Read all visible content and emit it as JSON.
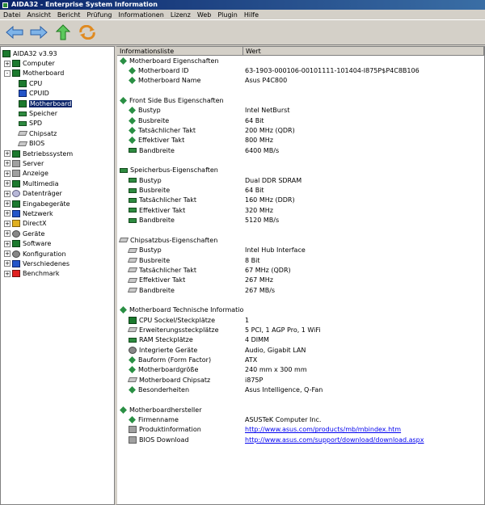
{
  "window": {
    "title": "AIDA32 - Enterprise System Information"
  },
  "menu": [
    "Datei",
    "Ansicht",
    "Bericht",
    "Prüfung",
    "Informationen",
    "Lizenz",
    "Web",
    "Plugin",
    "Hilfe"
  ],
  "toolbar": {
    "back_icon": "arrow-left-icon",
    "forward_icon": "arrow-right-icon",
    "up_icon": "arrow-up-icon",
    "refresh_icon": "refresh-icon"
  },
  "tree": {
    "root": "AIDA32 v3.93",
    "items": [
      {
        "label": "Computer",
        "level": 1,
        "exp": "+",
        "icon": "computer-icon"
      },
      {
        "label": "Motherboard",
        "level": 1,
        "exp": "-",
        "icon": "motherboard-icon"
      },
      {
        "label": "CPU",
        "level": 2,
        "exp": "",
        "icon": "cpu-icon"
      },
      {
        "label": "CPUID",
        "level": 2,
        "exp": "",
        "icon": "cpuid-icon"
      },
      {
        "label": "Motherboard",
        "level": 2,
        "exp": "",
        "icon": "motherboard-icon",
        "selected": true
      },
      {
        "label": "Speicher",
        "level": 2,
        "exp": "",
        "icon": "memory-icon"
      },
      {
        "label": "SPD",
        "level": 2,
        "exp": "",
        "icon": "memory-icon"
      },
      {
        "label": "Chipsatz",
        "level": 2,
        "exp": "",
        "icon": "chipset-icon"
      },
      {
        "label": "BIOS",
        "level": 2,
        "exp": "",
        "icon": "bios-icon"
      },
      {
        "label": "Betriebssystem",
        "level": 1,
        "exp": "+",
        "icon": "os-icon"
      },
      {
        "label": "Server",
        "level": 1,
        "exp": "+",
        "icon": "server-icon"
      },
      {
        "label": "Anzeige",
        "level": 1,
        "exp": "+",
        "icon": "display-icon"
      },
      {
        "label": "Multimedia",
        "level": 1,
        "exp": "+",
        "icon": "multimedia-icon"
      },
      {
        "label": "Datenträger",
        "level": 1,
        "exp": "+",
        "icon": "storage-icon"
      },
      {
        "label": "Eingabegeräte",
        "level": 1,
        "exp": "+",
        "icon": "input-devices-icon"
      },
      {
        "label": "Netzwerk",
        "level": 1,
        "exp": "+",
        "icon": "network-icon"
      },
      {
        "label": "DirectX",
        "level": 1,
        "exp": "+",
        "icon": "directx-icon"
      },
      {
        "label": "Geräte",
        "level": 1,
        "exp": "+",
        "icon": "devices-icon"
      },
      {
        "label": "Software",
        "level": 1,
        "exp": "+",
        "icon": "software-icon"
      },
      {
        "label": "Konfiguration",
        "level": 1,
        "exp": "+",
        "icon": "configuration-icon"
      },
      {
        "label": "Verschiedenes",
        "level": 1,
        "exp": "+",
        "icon": "misc-icon"
      },
      {
        "label": "Benchmark",
        "level": 1,
        "exp": "+",
        "icon": "benchmark-icon"
      }
    ]
  },
  "columns": [
    "Informationsliste",
    "Wert"
  ],
  "groups": [
    {
      "title": "Motherboard Eigenschaften",
      "icon": "diamond-icon",
      "rows": [
        {
          "field": "Motherboard ID",
          "value": "63-1903-000106-00101111-101404-I875P$P4C8B106",
          "icon": "diamond-icon"
        },
        {
          "field": "Motherboard Name",
          "value": "Asus P4C800",
          "icon": "diamond-icon"
        }
      ]
    },
    {
      "title": "Front Side Bus Eigenschaften",
      "icon": "diamond-icon",
      "rows": [
        {
          "field": "Bustyp",
          "value": "Intel NetBurst",
          "icon": "diamond-icon"
        },
        {
          "field": "Busbreite",
          "value": "64 Bit",
          "icon": "diamond-icon"
        },
        {
          "field": "Tatsächlicher Takt",
          "value": "200 MHz (QDR)",
          "icon": "diamond-icon"
        },
        {
          "field": "Effektiver Takt",
          "value": "800 MHz",
          "icon": "diamond-icon"
        },
        {
          "field": "Bandbreite",
          "value": "6400 MB/s",
          "icon": "memory-icon"
        }
      ]
    },
    {
      "title": "Speicherbus-Eigenschaften",
      "icon": "memory-icon",
      "rows": [
        {
          "field": "Bustyp",
          "value": "Dual DDR SDRAM",
          "icon": "memory-icon"
        },
        {
          "field": "Busbreite",
          "value": "64 Bit",
          "icon": "memory-icon"
        },
        {
          "field": "Tatsächlicher Takt",
          "value": "160 MHz (DDR)",
          "icon": "memory-icon"
        },
        {
          "field": "Effektiver Takt",
          "value": "320 MHz",
          "icon": "memory-icon"
        },
        {
          "field": "Bandbreite",
          "value": "5120 MB/s",
          "icon": "memory-icon"
        }
      ]
    },
    {
      "title": "Chipsatzbus-Eigenschaften",
      "icon": "chipset-icon",
      "rows": [
        {
          "field": "Bustyp",
          "value": "Intel Hub Interface",
          "icon": "chipset-icon"
        },
        {
          "field": "Busbreite",
          "value": "8 Bit",
          "icon": "chipset-icon"
        },
        {
          "field": "Tatsächlicher Takt",
          "value": "67 MHz (QDR)",
          "icon": "chipset-icon"
        },
        {
          "field": "Effektiver Takt",
          "value": "267 MHz",
          "icon": "chipset-icon"
        },
        {
          "field": "Bandbreite",
          "value": "267 MB/s",
          "icon": "chipset-icon"
        }
      ]
    },
    {
      "title": "Motherboard Technische Information",
      "icon": "diamond-icon",
      "rows": [
        {
          "field": "CPU Sockel/Steckplätze",
          "value": "1",
          "icon": "cpu-icon"
        },
        {
          "field": "Erweiterungssteckplätze",
          "value": "5 PCI, 1 AGP Pro, 1 WiFi",
          "icon": "card-icon"
        },
        {
          "field": "RAM Steckplätze",
          "value": "4 DIMM",
          "icon": "memory-icon"
        },
        {
          "field": "Integrierte Geräte",
          "value": "Audio, Gigabit LAN",
          "icon": "devices-icon"
        },
        {
          "field": "Bauform (Form Factor)",
          "value": "ATX",
          "icon": "diamond-icon"
        },
        {
          "field": "Motherboardgröße",
          "value": "240 mm x 300 mm",
          "icon": "diamond-icon"
        },
        {
          "field": "Motherboard Chipsatz",
          "value": "i875P",
          "icon": "chipset-icon"
        },
        {
          "field": "Besonderheiten",
          "value": "Asus Intelligence, Q-Fan",
          "icon": "diamond-icon"
        }
      ]
    },
    {
      "title": "Motherboardhersteller",
      "icon": "diamond-icon",
      "rows": [
        {
          "field": "Firmenname",
          "value": "ASUSTeK Computer Inc.",
          "icon": "diamond-icon"
        },
        {
          "field": "Produktinformation",
          "value": "http://www.asus.com/products/mb/mbindex.htm",
          "icon": "link-icon",
          "link": true
        },
        {
          "field": "BIOS Download",
          "value": "http://www.asus.com/support/download/download.aspx",
          "icon": "link-icon",
          "link": true
        }
      ]
    }
  ]
}
